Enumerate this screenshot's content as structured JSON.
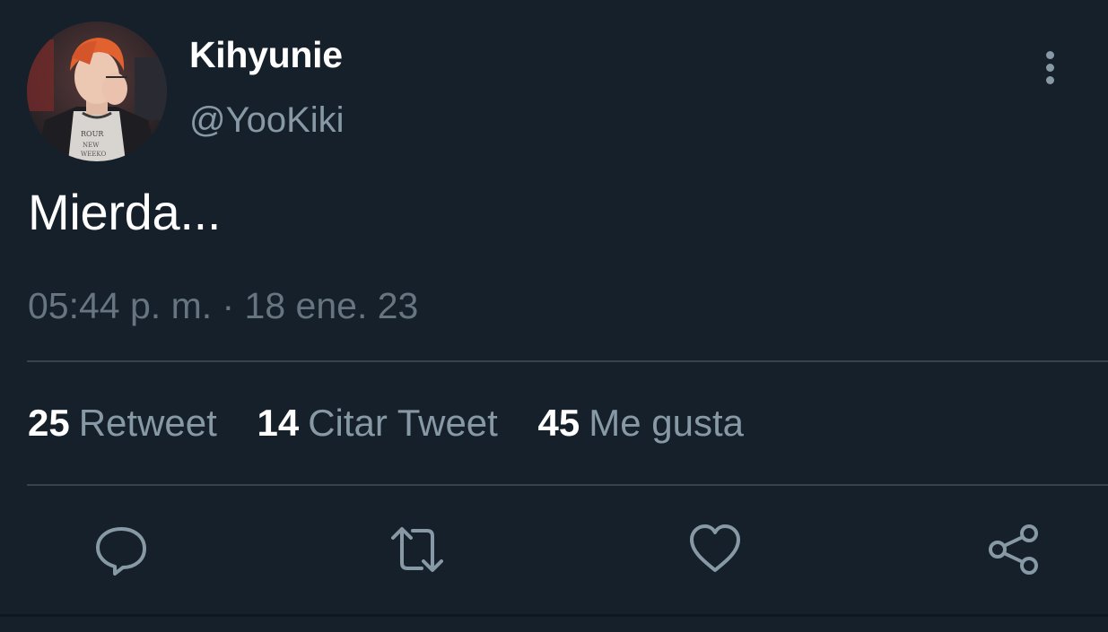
{
  "user": {
    "display_name": "Kihyunie",
    "handle": "@YooKiki"
  },
  "tweet": {
    "text": "Mierda...",
    "timestamp": "05:44 p. m. · 18 ene. 23"
  },
  "stats": [
    {
      "count": "25",
      "label": "Retweet"
    },
    {
      "count": "14",
      "label": "Citar Tweet"
    },
    {
      "count": "45",
      "label": "Me gusta"
    }
  ],
  "actions": [
    {
      "icon": "reply-icon"
    },
    {
      "icon": "retweet-icon"
    },
    {
      "icon": "like-icon"
    },
    {
      "icon": "share-icon"
    }
  ],
  "colors": {
    "background": "#16202b",
    "primary_text": "#ffffff",
    "secondary_text": "#8899a6",
    "divider": "#38444d"
  }
}
